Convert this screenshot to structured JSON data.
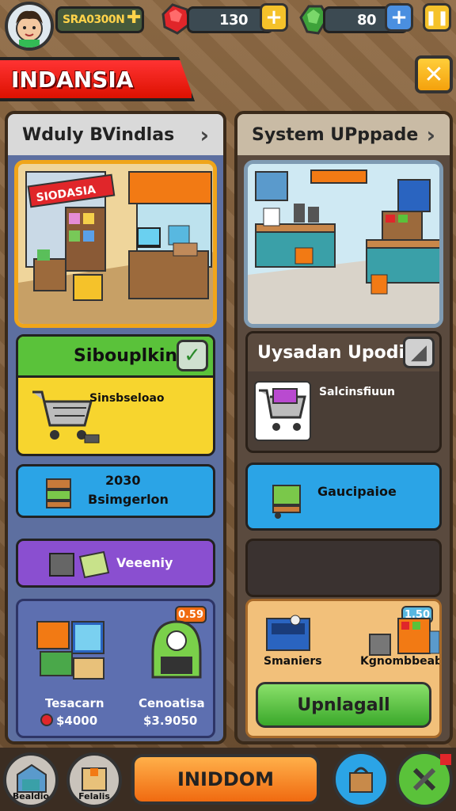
{
  "resources": {
    "coins_label": "SRA0300N",
    "gems_value": "130",
    "emeralds_value": "80"
  },
  "title_banner": "INDANSIA",
  "left_panel": {
    "header": "Wduly BVindlas",
    "card_green_title": "Sibouplkin",
    "card_yellow_text": "Sinsbseloao",
    "card_blue_value": "2030",
    "card_blue_text": "Bsimgerlon",
    "card_purple_text": "Veeeniy",
    "bottom_item1_label": "Tesacarn",
    "bottom_item1_value": "$4000",
    "bottom_item2_label": "Cenoatisa",
    "bottom_item2_value": "$3.9050",
    "bottom_badge": "0.59",
    "scene_sign": "SIODASIA"
  },
  "right_panel": {
    "header": "System UPppade",
    "card_title": "Uysadan Upodis",
    "card_item_label": "Salcinsfiuun",
    "card_blue_text": "Gaucipaioe",
    "bottom_item1_label": "Smaniers",
    "bottom_item2_label": "Kgnombbeabe",
    "bottom_badge": "1.50",
    "upgrade_button": "Upnlagall"
  },
  "bottom_bar": {
    "nav1_label": "Bealdio",
    "nav2_label": "Felalis",
    "main_button": "INIDDOM"
  },
  "colors": {
    "accent_red": "#e21f1a",
    "accent_orange": "#f27a14",
    "accent_green": "#5ac23a",
    "accent_blue": "#2ba4e6",
    "accent_purple": "#8a4fd0"
  }
}
